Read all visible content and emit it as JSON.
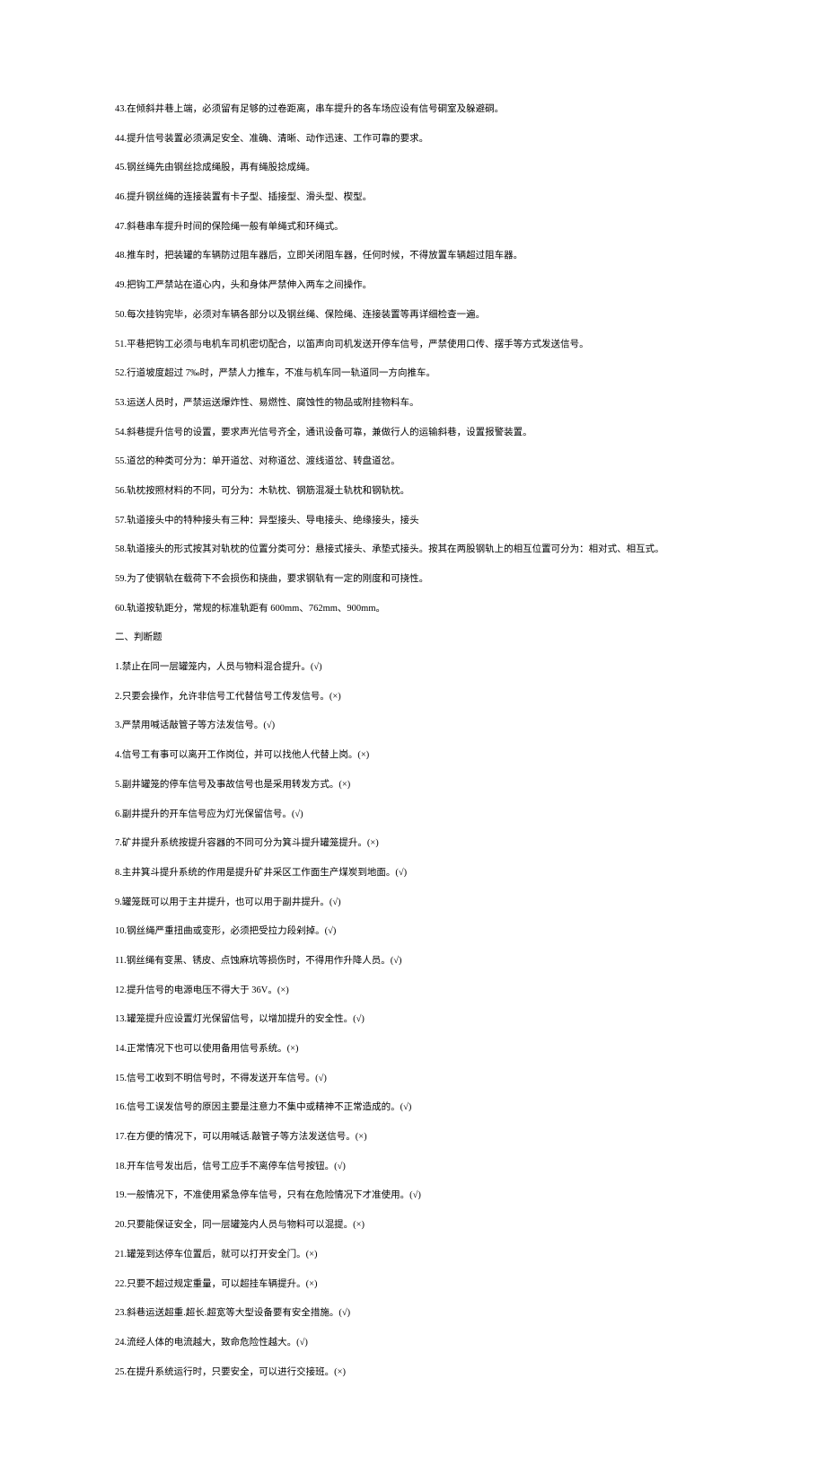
{
  "fill_blanks": [
    "43.在倾斜井巷上端，必须留有足够的过卷距离，串车提升的各车场应设有信号硐室及躲避硐。",
    "44.提升信号装置必须满足安全、准确、清晰、动作迅速、工作可靠的要求。",
    "45.钢丝绳先由钢丝捻成绳股，再有绳股捻成绳。",
    "46.提升钢丝绳的连接装置有卡子型、插接型、滑头型、楔型。",
    "47.斜巷串车提升时间的保险绳一般有单绳式和环绳式。",
    "48.推车时，把装罐的车辆防过阻车器后，立即关闭阻车器，任何时候，不得放置车辆超过阻车器。",
    "49.把钩工严禁站在道心内，头和身体严禁伸入两车之间操作。",
    "50.每次挂钩完毕，必须对车辆各部分以及钢丝绳、保险绳、连接装置等再详细检查一遍。",
    "51.平巷把钩工必须与电机车司机密切配合，以笛声向司机发送开停车信号，严禁使用口传、摆手等方式发送信号。",
    "52.行道坡度超过 7‰时，严禁人力推车，不准与机车同一轨道同一方向推车。",
    "53.运送人员时，严禁运送爆炸性、易燃性、腐蚀性的物品或附挂物料车。",
    "54.斜巷提升信号的设置，要求声光信号齐全，通讯设备可靠，兼做行人的运输斜巷，设置报警装置。",
    "55.道岔的种类可分为：单开道岔、对称道岔、渡线道岔、转盘道岔。",
    "56.轨枕按照材料的不同，可分为：木轨枕、钢筋混凝土轨枕和钢轨枕。",
    "57.轨道接头中的特种接头有三种：异型接头、导电接头、绝缘接头，接头",
    "58.轨道接头的形式按其对轨枕的位置分类可分：悬接式接头、承垫式接头。按其在两股钢轨上的相互位置可分为：相对式、相互式。",
    "59.为了使钢轨在载荷下不会损伤和挠曲，要求钢轨有一定的刚度和可挠性。",
    "60.轨道按轨距分，常规的标准轨距有 600mm、762mm、900mm。"
  ],
  "judgement_heading": "二、判断题",
  "judgements": [
    "1.禁止在同一层罐笼内，人员与物料混合提升。(√)",
    "2.只要会操作，允许非信号工代替信号工传发信号。(×)",
    "3.严禁用喊话敲管子等方法发信号。(√)",
    "4.信号工有事可以离开工作岗位，并可以找他人代替上岗。(×)",
    "5.副井罐笼的停车信号及事故信号也是采用转发方式。(×)",
    "6.副井提升的开车信号应为灯光保留信号。(√)",
    "7.矿井提升系统按提升容器的不同可分为箕斗提升罐笼提升。(×)",
    "8.主井箕斗提升系统的作用是提升矿井采区工作面生产煤炭到地面。(√)",
    "9.罐笼既可以用于主井提升，也可以用于副井提升。(√)",
    "10.钢丝绳严重扭曲或变形，必须把受拉力段剁掉。(√)",
    "11.钢丝绳有变黑、锈皮、点蚀麻坑等损伤时，不得用作升降人员。(√)",
    "12.提升信号的电源电压不得大于 36V。(×)",
    "13.罐笼提升应设置灯光保留信号，以增加提升的安全性。(√)",
    "14.正常情况下也可以使用备用信号系统。(×)",
    "15.信号工收到不明信号时，不得发送开车信号。(√)",
    "16.信号工误发信号的原因主要是注意力不集中或精神不正常造成的。(√)",
    "17.在方便的情况下，可以用喊话.敲管子等方法发送信号。(×)",
    "18.开车信号发出后，信号工应手不离停车信号按钮。(√)",
    "19.一般情况下，不准使用紧急停车信号，只有在危险情况下才准使用。(√)",
    "20.只要能保证安全，同一层罐笼内人员与物料可以混提。(×)",
    "21.罐笼到达停车位置后，就可以打开安全门。(×)",
    "22.只要不超过规定重量，可以超挂车辆提升。(×)",
    "23.斜巷运送超重.超长.超宽等大型设备要有安全措施。(√)",
    "24.流经人体的电流越大，致命危险性越大。(√)",
    "25.在提升系统运行时，只要安全，可以进行交接班。(×)"
  ]
}
